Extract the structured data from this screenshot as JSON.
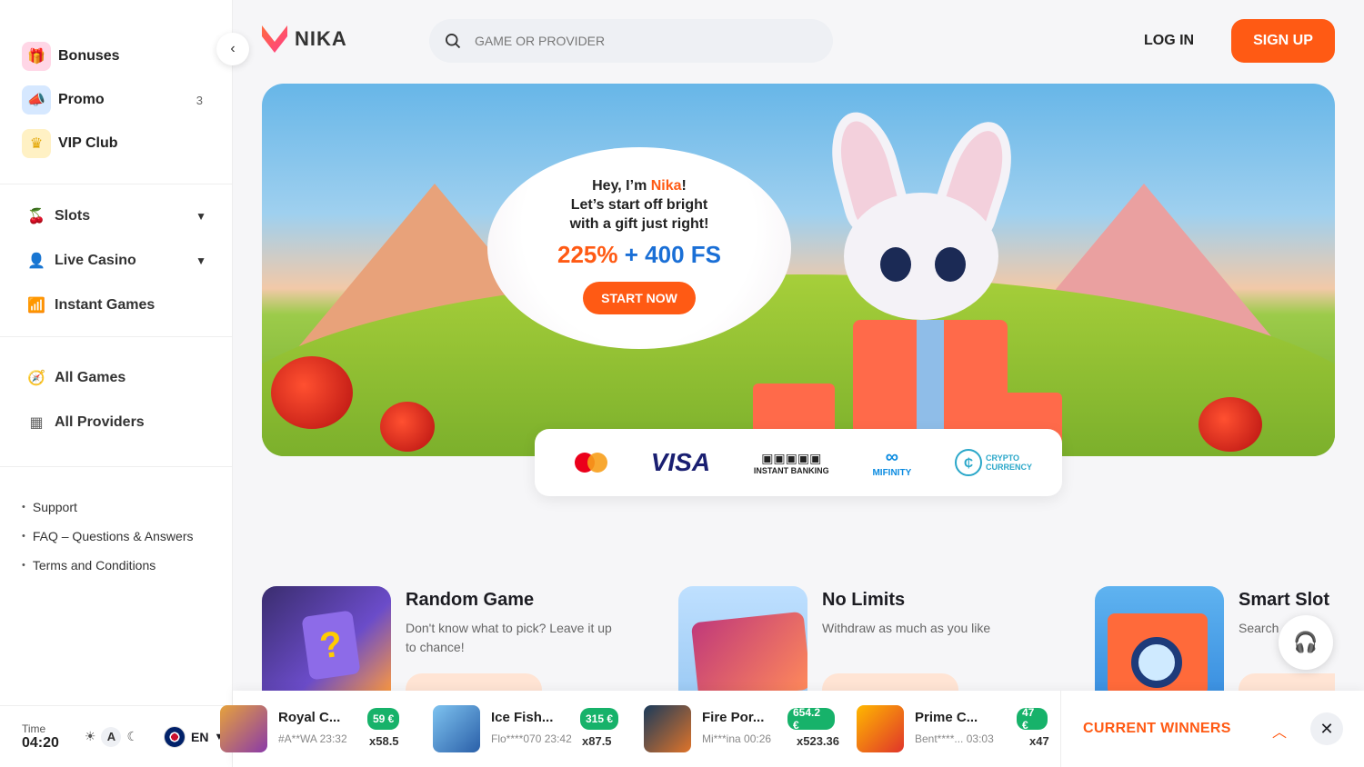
{
  "sidebar": {
    "promo_items": [
      {
        "label": "Bonuses",
        "count": ""
      },
      {
        "label": "Promo",
        "count": "3"
      },
      {
        "label": "VIP Club",
        "count": ""
      }
    ],
    "categories": [
      {
        "label": "Slots"
      },
      {
        "label": "Live Casino"
      },
      {
        "label": "Instant Games"
      }
    ],
    "games": [
      {
        "label": "All Games"
      },
      {
        "label": "All Providers"
      }
    ],
    "links": [
      "Support",
      "FAQ – Questions & Answers",
      "Terms and Conditions"
    ],
    "time_label": "Time",
    "time_value": "04:20",
    "theme_auto": "A",
    "language": "EN"
  },
  "header": {
    "logo_text": "NIKA",
    "search_placeholder": "GAME OR PROVIDER",
    "login": "LOG IN",
    "signup": "SIGN UP"
  },
  "banner": {
    "greeting_prefix": "Hey, I’m ",
    "greeting_name": "Nika",
    "greeting_suffix": "!",
    "line2": "Let’s start off bright",
    "line3": "with a gift just right!",
    "promo_pct": "225%",
    "promo_plus": " + ",
    "promo_fs": "400 FS",
    "cta": "START NOW"
  },
  "payments": {
    "visa": "VISA",
    "instant_banking": "INSTANT BANKING",
    "mifinity": "MIFINITY",
    "crypto": "CRYPTO CURRENCY"
  },
  "cards": [
    {
      "title": "Random Game",
      "desc": "Don't know what to pick? Leave it up to chance!"
    },
    {
      "title": "No Limits",
      "desc": "Withdraw as much as you like"
    },
    {
      "title": "Smart Slot",
      "desc": "Search"
    }
  ],
  "winners": {
    "label": "CURRENT WINNERS",
    "items": [
      {
        "game": "Royal C...",
        "user": "#A**WA",
        "time": "23:32",
        "amount": "59 €",
        "mult": "x58.5"
      },
      {
        "game": "Ice Fish...",
        "user": "Flo****070",
        "time": "23:42",
        "amount": "315 €",
        "mult": "x87.5"
      },
      {
        "game": "Fire Por...",
        "user": "Mi***ina",
        "time": "00:26",
        "amount": "654.2 €",
        "mult": "x523.36"
      },
      {
        "game": "Prime C...",
        "user": "Bent****...",
        "time": "03:03",
        "amount": "47 €",
        "mult": "x47"
      }
    ]
  },
  "colors": {
    "accent": "#ff5a14",
    "blue": "#1a6fd6",
    "win_green": "#17b26a"
  }
}
